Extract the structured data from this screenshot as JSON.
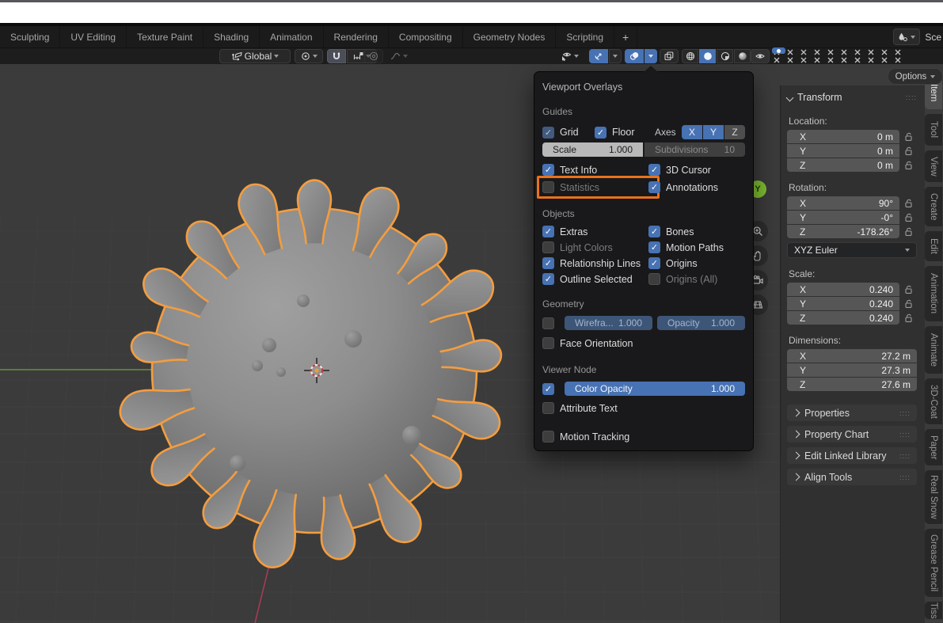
{
  "topbar": {
    "tabs": [
      "Sculpting",
      "UV Editing",
      "Texture Paint",
      "Shading",
      "Animation",
      "Rendering",
      "Compositing",
      "Geometry Nodes",
      "Scripting"
    ],
    "new_workspace_label": "+",
    "scene_label": "Sce"
  },
  "toolbar": {
    "orientation_label": "Global",
    "options_label": "Options",
    "icons": {
      "left": [
        "transform-orientation-icon",
        "pivot-point-icon",
        "magnet-snap-icon",
        "snap-target-icon",
        "proportional-editing-icon",
        "falloff-curve-icon"
      ],
      "right": [
        "object-visibility-eye-icon",
        "gizmo-icon",
        "overlays-icon",
        "xray-icon",
        "wireframe-shading-icon",
        "solid-shading-icon",
        "material-shading-icon",
        "rendered-shading-icon",
        "filter-eye-icon"
      ]
    }
  },
  "overlays": {
    "title": "Viewport Overlays",
    "guides": {
      "label": "Guides",
      "grid": {
        "label": "Grid",
        "checked": true,
        "muted": true
      },
      "floor": {
        "label": "Floor",
        "checked": true
      },
      "axes_label": "Axes",
      "axes": [
        {
          "label": "X",
          "on": true
        },
        {
          "label": "Y",
          "on": true
        },
        {
          "label": "Z",
          "on": false
        }
      ],
      "scale": {
        "label": "Scale",
        "value": "1.000",
        "style": "light"
      },
      "subdivisions": {
        "label": "Subdivisions",
        "value": "10",
        "style": "disabled"
      },
      "checks": [
        {
          "label": "Text Info",
          "checked": true
        },
        {
          "label": "3D Cursor",
          "checked": true
        },
        {
          "label": "Statistics",
          "checked": false,
          "dim": true,
          "highlighted": true
        },
        {
          "label": "Annotations",
          "checked": true
        }
      ]
    },
    "objects": {
      "label": "Objects",
      "checks": [
        {
          "label": "Extras",
          "checked": true
        },
        {
          "label": "Bones",
          "checked": true
        },
        {
          "label": "Light Colors",
          "checked": false,
          "dim": true
        },
        {
          "label": "Motion Paths",
          "checked": true
        },
        {
          "label": "Relationship Lines",
          "checked": true
        },
        {
          "label": "Origins",
          "checked": true
        },
        {
          "label": "Outline Selected",
          "checked": true
        },
        {
          "label": "Origins (All)",
          "checked": false,
          "dim": true
        }
      ]
    },
    "geometry": {
      "label": "Geometry",
      "checkbox_checked": false,
      "wireframe": {
        "label": "Wirefra...",
        "value": "1.000",
        "style": "mutedblue"
      },
      "opacity": {
        "label": "Opacity",
        "value": "1.000",
        "style": "mutedblue"
      },
      "face_orientation": {
        "label": "Face Orientation",
        "checked": false
      }
    },
    "viewer_node": {
      "label": "Viewer Node",
      "checkbox_checked": true,
      "color_opacity": {
        "label": "Color Opacity",
        "value": "1.000",
        "style": "active"
      },
      "attribute_text": {
        "label": "Attribute Text",
        "checked": false
      }
    },
    "motion_tracking": {
      "label": "Motion Tracking",
      "checked": false
    }
  },
  "sidebar": {
    "transform_title": "Transform",
    "location": {
      "label": "Location:",
      "fields": [
        {
          "axis": "X",
          "value": "0 m"
        },
        {
          "axis": "Y",
          "value": "0 m"
        },
        {
          "axis": "Z",
          "value": "0 m"
        }
      ],
      "locks": true
    },
    "rotation": {
      "label": "Rotation:",
      "fields": [
        {
          "axis": "X",
          "value": "90°"
        },
        {
          "axis": "Y",
          "value": "-0°"
        },
        {
          "axis": "Z",
          "value": "-178.26°"
        }
      ],
      "locks": true,
      "mode": "XYZ Euler"
    },
    "scale": {
      "label": "Scale:",
      "fields": [
        {
          "axis": "X",
          "value": "0.240"
        },
        {
          "axis": "Y",
          "value": "0.240"
        },
        {
          "axis": "Z",
          "value": "0.240"
        }
      ],
      "locks": true
    },
    "dimensions": {
      "label": "Dimensions:",
      "fields": [
        {
          "axis": "X",
          "value": "27.2 m"
        },
        {
          "axis": "Y",
          "value": "27.3 m"
        },
        {
          "axis": "Z",
          "value": "27.6 m"
        }
      ],
      "locks": false
    },
    "collapsed_panels": [
      "Properties",
      "Property Chart",
      "Edit Linked Library",
      "Align Tools"
    ],
    "tabs": [
      {
        "label": "Item",
        "active": true
      },
      {
        "label": "Tool"
      },
      {
        "label": "View"
      },
      {
        "label": "Create"
      },
      {
        "label": "Edit"
      },
      {
        "label": "Animation"
      },
      {
        "label": "Animate"
      },
      {
        "label": "3D-Coat"
      },
      {
        "label": "Paper"
      },
      {
        "label": "Real Snow"
      },
      {
        "label": "Grease Pencil"
      },
      {
        "label": "Tiss"
      }
    ]
  },
  "viewport": {
    "gizmo_axis_label": "Y",
    "colors": {
      "background": "#3b3b3b",
      "grid_line": "#474747",
      "axis_y_green": "#6b8e3a",
      "axis_x_red": "#a63b55",
      "selection_outline": "#f49d3f",
      "statistics_highlight": "#e8721c",
      "accent_blue": "#4772b3"
    }
  }
}
